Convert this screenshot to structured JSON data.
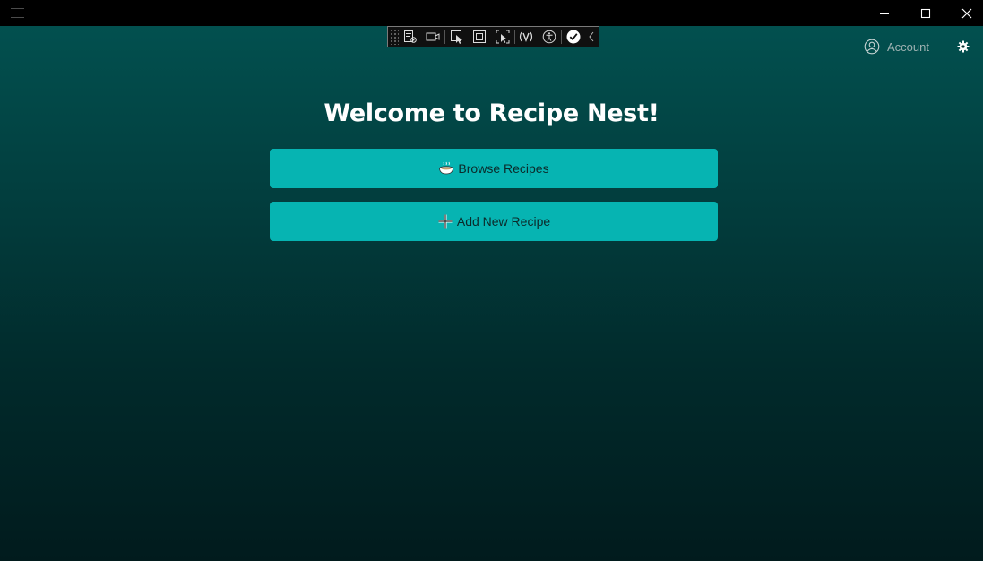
{
  "titlebar": {
    "menu_icon": "hamburger-icon",
    "minimize_icon": "minimize-icon",
    "maximize_icon": "maximize-icon",
    "close_icon": "close-icon"
  },
  "devbar": {
    "tools": [
      "live-visual-tree-icon",
      "video-icon",
      "select-element-icon",
      "layout-adorner-icon",
      "track-focus-icon",
      "hot-reload-icon",
      "accessibility-icon",
      "checkmark-icon",
      "collapse-chevron-icon"
    ]
  },
  "header": {
    "account_label": "Account",
    "account_icon": "user-circle-icon",
    "settings_icon": "gear-icon"
  },
  "main": {
    "title": "Welcome to Recipe Nest!",
    "browse_label": "Browse Recipes",
    "browse_icon": "bowl-icon",
    "add_label": "Add New Recipe",
    "add_icon": "plus-icon"
  },
  "colors": {
    "accent": "#06b4b2",
    "background_top": "#02504f",
    "background_bottom": "#011b1d",
    "titlebar": "#000000"
  }
}
